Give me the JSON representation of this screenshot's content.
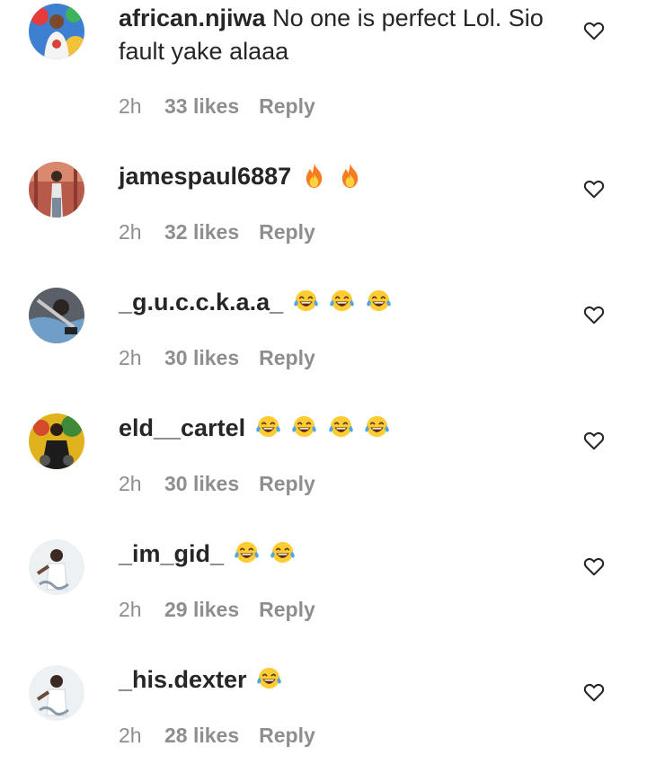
{
  "comments": [
    {
      "username": "african.njiwa",
      "text": "No one is perfect Lol. Sio fault yake alaaa",
      "emojis": [],
      "time": "2h",
      "likes": "33 likes",
      "reply": "Reply",
      "avatar_icon": "avatar-icon"
    },
    {
      "username": "jamespaul6887",
      "text": "",
      "emojis": [
        "fire-emoji",
        "fire-emoji"
      ],
      "time": "2h",
      "likes": "32 likes",
      "reply": "Reply",
      "avatar_icon": "avatar-icon"
    },
    {
      "username": "_g.u.c.c.k.a.a_",
      "text": "",
      "emojis": [
        "tears-of-joy-emoji",
        "tears-of-joy-emoji",
        "tears-of-joy-emoji"
      ],
      "time": "2h",
      "likes": "30 likes",
      "reply": "Reply",
      "avatar_icon": "avatar-icon"
    },
    {
      "username": "eld__cartel",
      "text": "",
      "emojis": [
        "tears-of-joy-emoji",
        "tears-of-joy-emoji",
        "tears-of-joy-emoji",
        "tears-of-joy-emoji"
      ],
      "time": "2h",
      "likes": "30 likes",
      "reply": "Reply",
      "avatar_icon": "avatar-icon"
    },
    {
      "username": "_im_gid_",
      "text": "",
      "emojis": [
        "tears-of-joy-emoji",
        "tears-of-joy-emoji"
      ],
      "time": "2h",
      "likes": "29 likes",
      "reply": "Reply",
      "avatar_icon": "avatar-icon"
    },
    {
      "username": "_his.dexter",
      "text": "",
      "emojis": [
        "tears-of-joy-emoji"
      ],
      "time": "2h",
      "likes": "28 likes",
      "reply": "Reply",
      "avatar_icon": "avatar-icon"
    }
  ],
  "icons": {
    "like": "heart-outline-icon"
  },
  "colors": {
    "text_primary": "#262626",
    "text_secondary": "#8e8e8e",
    "background": "#ffffff"
  }
}
